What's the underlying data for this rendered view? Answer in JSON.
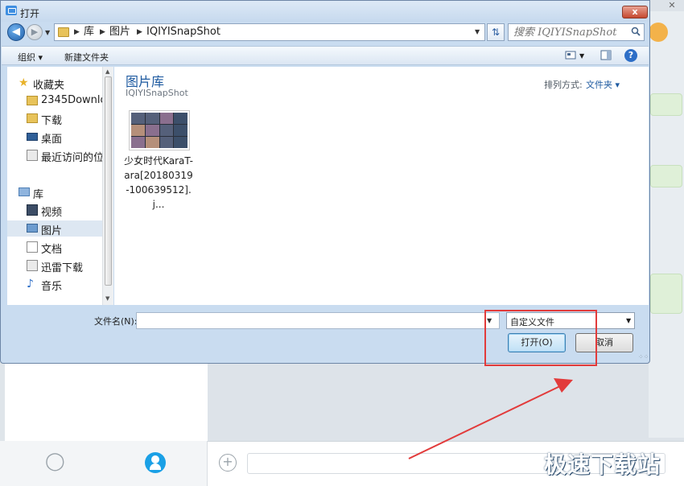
{
  "dialog": {
    "title": "打开",
    "close_label": "x",
    "breadcrumbs": [
      "库",
      "图片",
      "IQIYISnapShot"
    ],
    "search_placeholder": "搜索 IQIYISnapShot",
    "toolbar": {
      "organize": "组织",
      "new_folder": "新建文件夹"
    },
    "nav": {
      "favorites": "收藏夹",
      "fav_items": [
        "2345Downlo",
        "下载",
        "桌面",
        "最近访问的位"
      ],
      "library": "库",
      "lib_items": [
        "视频",
        "图片",
        "文档",
        "迅雷下载",
        "音乐"
      ]
    },
    "content": {
      "title": "图片库",
      "subtitle": "IQIYISnapShot",
      "sort_label": "排列方式:",
      "sort_value": "文件夹 ▾",
      "files": [
        {
          "name": "少女时代KaraT-ara[20180319-100639512].j..."
        }
      ]
    },
    "filename_label": "文件名(N):",
    "filename_value": "",
    "filetype_value": "自定义文件",
    "open_button": "打开(O)",
    "cancel_button": "取消"
  },
  "background_app": {
    "watermark": "极速下载站"
  },
  "colors": {
    "accent": "#1e5aa0",
    "highlight_red": "#e23b3b",
    "primary_blue": "#1aa0e6"
  }
}
